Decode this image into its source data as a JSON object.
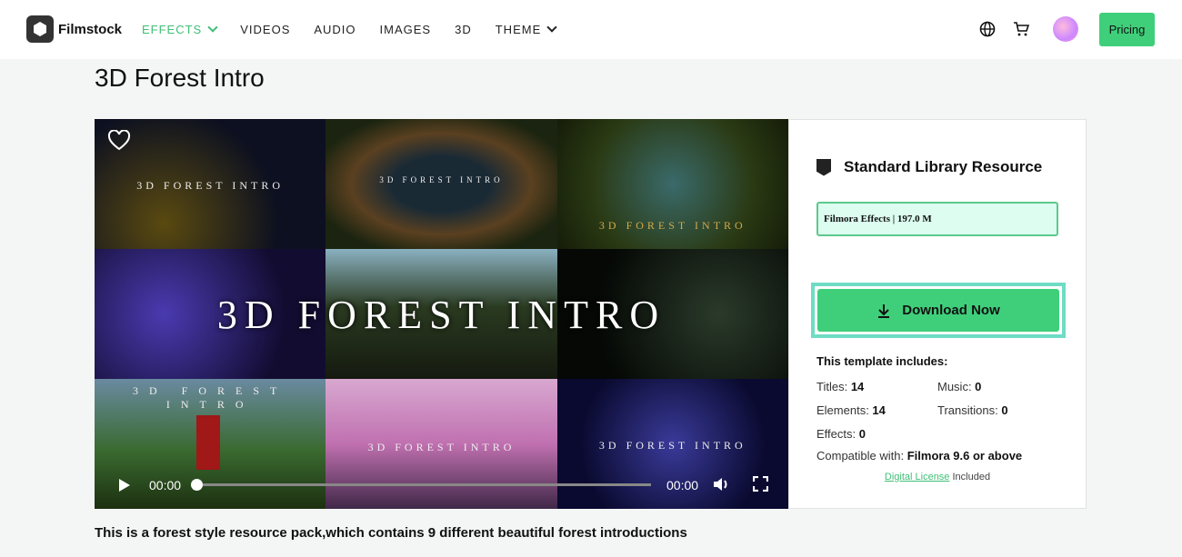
{
  "nav": {
    "brand": "Filmstock",
    "menu": [
      "EFFECTS",
      "VIDEOS",
      "AUDIO",
      "IMAGES",
      "3D",
      "THEME"
    ],
    "pricing": "Pricing",
    "accent": "#3fcf7a"
  },
  "page": {
    "title": "3D Forest Intro",
    "description": "This is a forest style resource pack,which contains 9 different beautiful forest introductions"
  },
  "video": {
    "overlay_title": "3D FOREST INTRO",
    "thumb_labels": [
      "3D FOREST INTRO",
      "3D FOREST INTRO",
      "3D FOREST INTRO",
      "3D FOREST INTRO",
      "3D FOREST INTRO",
      "3D FOREST INTRO"
    ],
    "current_time": "00:00",
    "duration": "00:00",
    "progress": 0
  },
  "panel": {
    "resource": "Standard Library Resource",
    "file_info": "Filmora Effects | 197.0 M",
    "download": "Download Now",
    "includes_heading": "This template includes:",
    "items": [
      {
        "label": "Titles: ",
        "value": "14"
      },
      {
        "label": "Music: ",
        "value": "0"
      },
      {
        "label": "Elements: ",
        "value": "14"
      },
      {
        "label": "Transitions: ",
        "value": "0"
      },
      {
        "label": "Effects: ",
        "value": "0"
      }
    ],
    "compat_label": "Compatible with: ",
    "compat_value": "Filmora 9.6 or above",
    "license_link": "Digital License",
    "license_suffix": " Included"
  }
}
